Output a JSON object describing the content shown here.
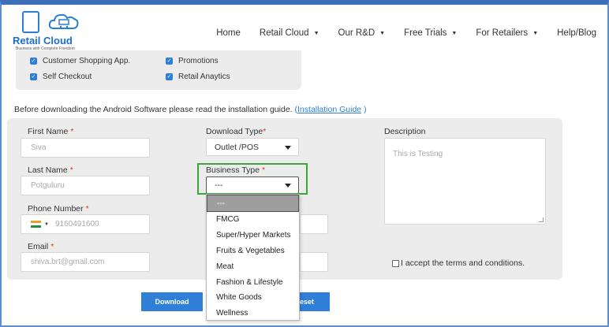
{
  "header": {
    "logo_name": "Retail Cloud",
    "logo_tagline": "Business with Complete Freedom",
    "nav": [
      {
        "label": "Home",
        "has_caret": false
      },
      {
        "label": "Retail Cloud",
        "has_caret": true
      },
      {
        "label": "Our R&D",
        "has_caret": true
      },
      {
        "label": "Free Trials",
        "has_caret": true
      },
      {
        "label": "For Retailers",
        "has_caret": true
      },
      {
        "label": "Help/Blog",
        "has_caret": false
      }
    ]
  },
  "features": [
    {
      "label": "Customer Shopping App.",
      "checked": true
    },
    {
      "label": "Promotions",
      "checked": true
    },
    {
      "label": "Self Checkout",
      "checked": true
    },
    {
      "label": "Retail Anaytics",
      "checked": true
    }
  ],
  "notice": {
    "text": "Before downloading the Android Software please read the installation guide.",
    "link_open": "(",
    "link": "Installation Guide",
    "link_close": ")"
  },
  "form": {
    "first_name": {
      "label": "First Name",
      "required": "*",
      "value": "Siva"
    },
    "last_name": {
      "label": "Last Name",
      "required": "*",
      "value": "Potguluru"
    },
    "phone": {
      "label": "Phone Number",
      "required": "*",
      "value": "9160491600"
    },
    "email": {
      "label": "Email",
      "required": "*",
      "value": "shiva.brt@gmail.com"
    },
    "download_type": {
      "label": "Download Type",
      "required": "*",
      "value": "Outlet /POS"
    },
    "business_type": {
      "label": "Business Type",
      "required": "*",
      "value": "---",
      "options": [
        "---",
        "FMCG",
        "Super/Hyper Markets",
        "Fruits & Vegetables",
        "Meat",
        "Fashion & Lifestyle",
        "White Goods",
        "Wellness"
      ],
      "highlight_color": "#3aa63a"
    },
    "description": {
      "label": "Description",
      "value": "This is Testing"
    },
    "terms": {
      "label": "I accept the terms and conditions.",
      "checked": false
    }
  },
  "buttons": {
    "download": "Download",
    "reset": "Reset"
  },
  "colors": {
    "accent": "#2f7fd8",
    "required": "#e0342f",
    "panel": "#ececec"
  }
}
